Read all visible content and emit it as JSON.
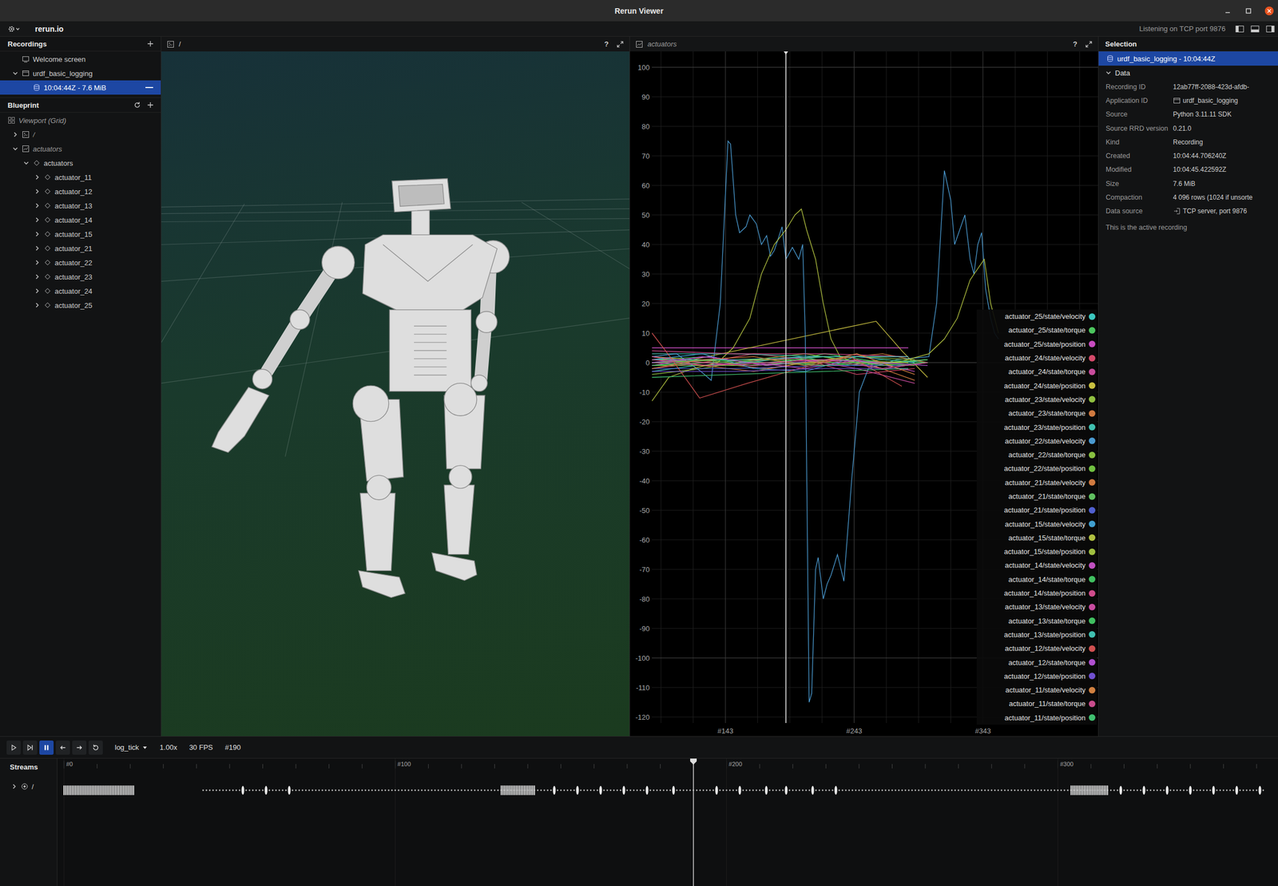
{
  "window": {
    "title": "Rerun Viewer"
  },
  "top_bar": {
    "brand": "rerun.io",
    "status": "Listening on TCP port 9876"
  },
  "recordings": {
    "title": "Recordings",
    "items": [
      {
        "label": "Welcome screen",
        "kind": "welcome",
        "selected": false
      },
      {
        "label": "urdf_basic_logging",
        "kind": "app",
        "expanded": true,
        "selected": false,
        "children": [
          {
            "label": "10:04:44Z - 7.6 MiB",
            "kind": "recording",
            "selected": true
          }
        ]
      }
    ]
  },
  "blueprint": {
    "title": "Blueprint",
    "items": [
      {
        "label": "Viewport (Grid)",
        "kind": "viewport",
        "selected": false,
        "children": [
          {
            "label": "/",
            "kind": "spatial",
            "expanded": false,
            "selected": false
          },
          {
            "label": "actuators",
            "kind": "timeseries",
            "expanded": true,
            "selected": false,
            "children": [
              {
                "label": "actuators",
                "kind": "entity",
                "expanded": true,
                "selected": false,
                "children": [
                  {
                    "label": "actuator_11",
                    "kind": "entity",
                    "expanded": false,
                    "selected": false
                  },
                  {
                    "label": "actuator_12",
                    "kind": "entity",
                    "expanded": false,
                    "selected": false
                  },
                  {
                    "label": "actuator_13",
                    "kind": "entity",
                    "expanded": false,
                    "selected": false
                  },
                  {
                    "label": "actuator_14",
                    "kind": "entity",
                    "expanded": false,
                    "selected": false
                  },
                  {
                    "label": "actuator_15",
                    "kind": "entity",
                    "expanded": false,
                    "selected": false
                  },
                  {
                    "label": "actuator_21",
                    "kind": "entity",
                    "expanded": false,
                    "selected": false
                  },
                  {
                    "label": "actuator_22",
                    "kind": "entity",
                    "expanded": false,
                    "selected": false
                  },
                  {
                    "label": "actuator_23",
                    "kind": "entity",
                    "expanded": false,
                    "selected": false
                  },
                  {
                    "label": "actuator_24",
                    "kind": "entity",
                    "expanded": false,
                    "selected": false
                  },
                  {
                    "label": "actuator_25",
                    "kind": "entity",
                    "expanded": false,
                    "selected": false
                  }
                ]
              }
            ]
          }
        ]
      }
    ]
  },
  "views": [
    {
      "title": "/",
      "help": "?"
    },
    {
      "title": "actuators",
      "help": "?"
    }
  ],
  "chart": {
    "y_ticks": [
      "100",
      "90",
      "80",
      "70",
      "60",
      "50",
      "40",
      "30",
      "20",
      "10",
      "0",
      "-10",
      "-20",
      "-30",
      "-40",
      "-50",
      "-60",
      "-70",
      "-80",
      "-90",
      "-100",
      "-110",
      "-120"
    ],
    "x_ticks": [
      "#143",
      "#243",
      "#343"
    ],
    "series": [
      {
        "label": "actuator_25/state/velocity",
        "color": "#3cc8c0",
        "ticks": [
          86,
          120,
          160,
          200,
          240,
          280,
          300
        ],
        "values": [
          -3,
          -1,
          0,
          2,
          -1,
          0,
          1
        ]
      },
      {
        "label": "actuator_25/state/torque",
        "color": "#4cc65e",
        "ticks": [
          86,
          130,
          175,
          220,
          265,
          300
        ],
        "values": [
          1,
          2,
          -1,
          3,
          0,
          1
        ]
      },
      {
        "label": "actuator_25/state/position",
        "color": "#c84cc0",
        "ticks": [
          86,
          150,
          200,
          285
        ],
        "values": [
          5,
          5,
          5,
          5
        ]
      },
      {
        "label": "actuator_24/state/velocity",
        "color": "#d44a6a",
        "ticks": [
          86,
          125,
          165,
          205,
          245,
          290
        ],
        "values": [
          -2,
          0,
          3,
          1,
          -4,
          -2
        ]
      },
      {
        "label": "actuator_24/state/torque",
        "color": "#c84c9c",
        "ticks": [
          86,
          130,
          175,
          220,
          265,
          300
        ],
        "values": [
          0,
          -1,
          1,
          2,
          -2,
          0
        ]
      },
      {
        "label": "actuator_24/state/position",
        "color": "#c8c040",
        "ticks": [
          86,
          118,
          260,
          280,
          300
        ],
        "values": [
          2,
          1,
          14,
          4,
          -5
        ]
      },
      {
        "label": "actuator_23/state/velocity",
        "color": "#90c040",
        "ticks": [
          86,
          125,
          165,
          205,
          245,
          290
        ],
        "values": [
          -4,
          -2,
          1,
          3,
          0,
          -1
        ]
      },
      {
        "label": "actuator_23/state/torque",
        "color": "#d07a40",
        "ticks": [
          86,
          130,
          175,
          220,
          265,
          300
        ],
        "values": [
          1,
          0,
          -2,
          1,
          3,
          0
        ]
      },
      {
        "label": "actuator_23/state/position",
        "color": "#40c0b0",
        "ticks": [
          86,
          150,
          220,
          285
        ],
        "values": [
          3,
          3,
          2,
          2
        ]
      },
      {
        "label": "actuator_22/state/velocity",
        "color": "#4a9ad0",
        "ticks": [
          86,
          105,
          124,
          132,
          139,
          145,
          147,
          151,
          154,
          159,
          162,
          167,
          171,
          175,
          178,
          181,
          184,
          187,
          190,
          195,
          200,
          203,
          205,
          208,
          210,
          213,
          215,
          219,
          222,
          225,
          230,
          235,
          241,
          247,
          254,
          276,
          301,
          307,
          313,
          318,
          321,
          325,
          329,
          333,
          336,
          339,
          342,
          345,
          349,
          352,
          355
        ],
        "values": [
          2,
          3,
          -3,
          -6,
          20,
          75,
          74,
          50,
          44,
          46,
          50,
          47,
          40,
          43,
          36,
          38,
          42,
          46,
          35,
          39,
          35,
          40,
          10,
          -115,
          -112,
          -70,
          -66,
          -80,
          -75,
          -72,
          -65,
          -74,
          -40,
          -10,
          -2,
          1,
          2,
          20,
          65,
          55,
          40,
          45,
          50,
          35,
          30,
          40,
          44,
          25,
          15,
          10,
          8
        ]
      },
      {
        "label": "actuator_22/state/torque",
        "color": "#88c040",
        "ticks": [
          86,
          125,
          165,
          205,
          245,
          290
        ],
        "values": [
          0,
          1,
          -1,
          0,
          2,
          1
        ]
      },
      {
        "label": "actuator_22/state/position",
        "color": "#70c040",
        "ticks": [
          86,
          150,
          220,
          285
        ],
        "values": [
          -1,
          -1,
          0,
          0
        ]
      },
      {
        "label": "actuator_21/state/velocity",
        "color": "#d07a40",
        "ticks": [
          86,
          125,
          165,
          205,
          245,
          290
        ],
        "values": [
          2,
          -1,
          -3,
          0,
          1,
          -6
        ]
      },
      {
        "label": "actuator_21/state/torque",
        "color": "#60c060",
        "ticks": [
          86,
          130,
          175,
          220,
          265,
          300
        ],
        "values": [
          -1,
          0,
          1,
          -1,
          0,
          1
        ]
      },
      {
        "label": "actuator_21/state/position",
        "color": "#5060d0",
        "ticks": [
          86,
          150,
          220,
          285
        ],
        "values": [
          -2,
          -2,
          -1,
          -1
        ]
      },
      {
        "label": "actuator_15/state/velocity",
        "color": "#40a0d0",
        "ticks": [
          86,
          125,
          165,
          205,
          245,
          290
        ],
        "values": [
          1,
          3,
          -2,
          -3,
          2,
          0
        ]
      },
      {
        "label": "actuator_15/state/torque",
        "color": "#b0c040",
        "ticks": [
          86,
          99,
          118,
          137,
          149,
          162,
          171,
          181,
          190,
          197,
          202,
          206,
          213,
          219,
          225,
          232,
          244,
          276,
          301,
          313,
          323,
          333,
          344,
          349,
          355
        ],
        "values": [
          -13,
          -5,
          -2,
          0,
          5,
          15,
          30,
          40,
          45,
          50,
          52,
          45,
          35,
          20,
          8,
          2,
          0,
          0,
          3,
          8,
          15,
          28,
          35,
          20,
          10
        ]
      },
      {
        "label": "actuator_15/state/position",
        "color": "#a0c040",
        "ticks": [
          86,
          150,
          220,
          285
        ],
        "values": [
          0,
          1,
          1,
          0
        ]
      },
      {
        "label": "actuator_14/state/velocity",
        "color": "#c050c0",
        "ticks": [
          86,
          125,
          165,
          205,
          245,
          290
        ],
        "values": [
          -1,
          2,
          0,
          -2,
          1,
          -3
        ]
      },
      {
        "label": "actuator_14/state/torque",
        "color": "#40c060",
        "ticks": [
          86,
          130,
          175,
          220,
          265,
          300
        ],
        "values": [
          0,
          1,
          0,
          -1,
          1,
          0
        ]
      },
      {
        "label": "actuator_14/state/position",
        "color": "#d04c8c",
        "ticks": [
          86,
          150,
          220,
          285
        ],
        "values": [
          4,
          3,
          3,
          2
        ]
      },
      {
        "label": "actuator_13/state/velocity",
        "color": "#c84ca0",
        "ticks": [
          86,
          125,
          165,
          205,
          245,
          290
        ],
        "values": [
          2,
          0,
          -1,
          1,
          -2,
          -7
        ]
      },
      {
        "label": "actuator_13/state/torque",
        "color": "#40c060",
        "ticks": [
          86,
          130,
          175,
          220,
          265,
          300
        ],
        "values": [
          -1,
          1,
          0,
          2,
          -1,
          0
        ]
      },
      {
        "label": "actuator_13/state/position",
        "color": "#40c0b0",
        "ticks": [
          86,
          150,
          220,
          285
        ],
        "values": [
          1,
          1,
          2,
          2
        ]
      },
      {
        "label": "actuator_12/state/velocity",
        "color": "#d05050",
        "ticks": [
          86,
          100,
          123,
          160,
          200,
          240,
          280
        ],
        "values": [
          10,
          2,
          -12,
          -7,
          -2,
          2,
          -8
        ]
      },
      {
        "label": "actuator_12/state/torque",
        "color": "#b050d0",
        "ticks": [
          86,
          130,
          175,
          220,
          265,
          300
        ],
        "values": [
          0,
          2,
          -1,
          1,
          0,
          -1
        ]
      },
      {
        "label": "actuator_12/state/position",
        "color": "#7050d0",
        "ticks": [
          86,
          150,
          220,
          285
        ],
        "values": [
          -3,
          -3,
          -2,
          -2
        ]
      },
      {
        "label": "actuator_11/state/velocity",
        "color": "#d08040",
        "ticks": [
          86,
          125,
          165,
          205,
          245,
          290
        ],
        "values": [
          -2,
          1,
          2,
          -1,
          3,
          -4
        ]
      },
      {
        "label": "actuator_11/state/torque",
        "color": "#c84c8c",
        "ticks": [
          86,
          130,
          175,
          220,
          265,
          300
        ],
        "values": [
          1,
          -1,
          0,
          1,
          -2,
          0
        ]
      },
      {
        "label": "actuator_11/state/position",
        "color": "#40c070",
        "ticks": [
          86,
          150,
          220,
          285
        ],
        "values": [
          -5,
          -4,
          -3,
          -2
        ]
      }
    ]
  },
  "selection": {
    "title": "Selection",
    "item": "urdf_basic_logging - 10:04:44Z",
    "section": {
      "title": "Data",
      "expanded": true
    },
    "rows": [
      {
        "key": "Recording ID",
        "value": "12ab77ff-2088-423d-afdb-",
        "kind": "text"
      },
      {
        "key": "Application ID",
        "value": "urdf_basic_logging",
        "kind": "app"
      },
      {
        "key": "Source",
        "value": "Python 3.11.11 SDK",
        "kind": "text"
      },
      {
        "key": "Source RRD version",
        "value": "0.21.0",
        "kind": "text"
      },
      {
        "key": "Kind",
        "value": "Recording",
        "kind": "text"
      },
      {
        "key": "Created",
        "value": "10:04:44.706240Z",
        "kind": "text"
      },
      {
        "key": "Modified",
        "value": "10:04:45.422592Z",
        "kind": "text"
      },
      {
        "key": "Size",
        "value": "7.6 MiB",
        "kind": "text"
      },
      {
        "key": "Compaction",
        "value": "4 096 rows (1024 if unsorte",
        "kind": "text"
      },
      {
        "key": "Data source",
        "value": "TCP server, port 9876",
        "kind": "source"
      }
    ],
    "note": "This is the active recording"
  },
  "time_panel": {
    "buttons": [
      {
        "kind": "play",
        "selected": false
      },
      {
        "kind": "follow",
        "selected": false
      },
      {
        "kind": "pause",
        "selected": true
      },
      {
        "kind": "step-back",
        "selected": false
      },
      {
        "kind": "step-forward",
        "selected": false
      },
      {
        "kind": "loop",
        "selected": false
      }
    ],
    "timeline": "log_tick",
    "speed": "1.00x",
    "fps": "30 FPS",
    "current": "#190"
  },
  "streams": {
    "title": "Streams",
    "ruler": [
      "#0",
      "#100",
      "#200",
      "#300"
    ],
    "rows": [
      {
        "label": "/",
        "expanded": false
      }
    ],
    "dense": [
      [
        0,
        21
      ],
      [
        132,
        142
      ],
      [
        304,
        315
      ]
    ],
    "baseline": [
      42,
      362
    ],
    "markers": [
      54,
      61,
      68,
      148,
      155,
      162,
      169,
      176,
      184,
      197,
      204,
      212,
      218,
      226,
      233,
      319,
      326,
      333,
      340,
      347,
      354,
      361
    ]
  }
}
